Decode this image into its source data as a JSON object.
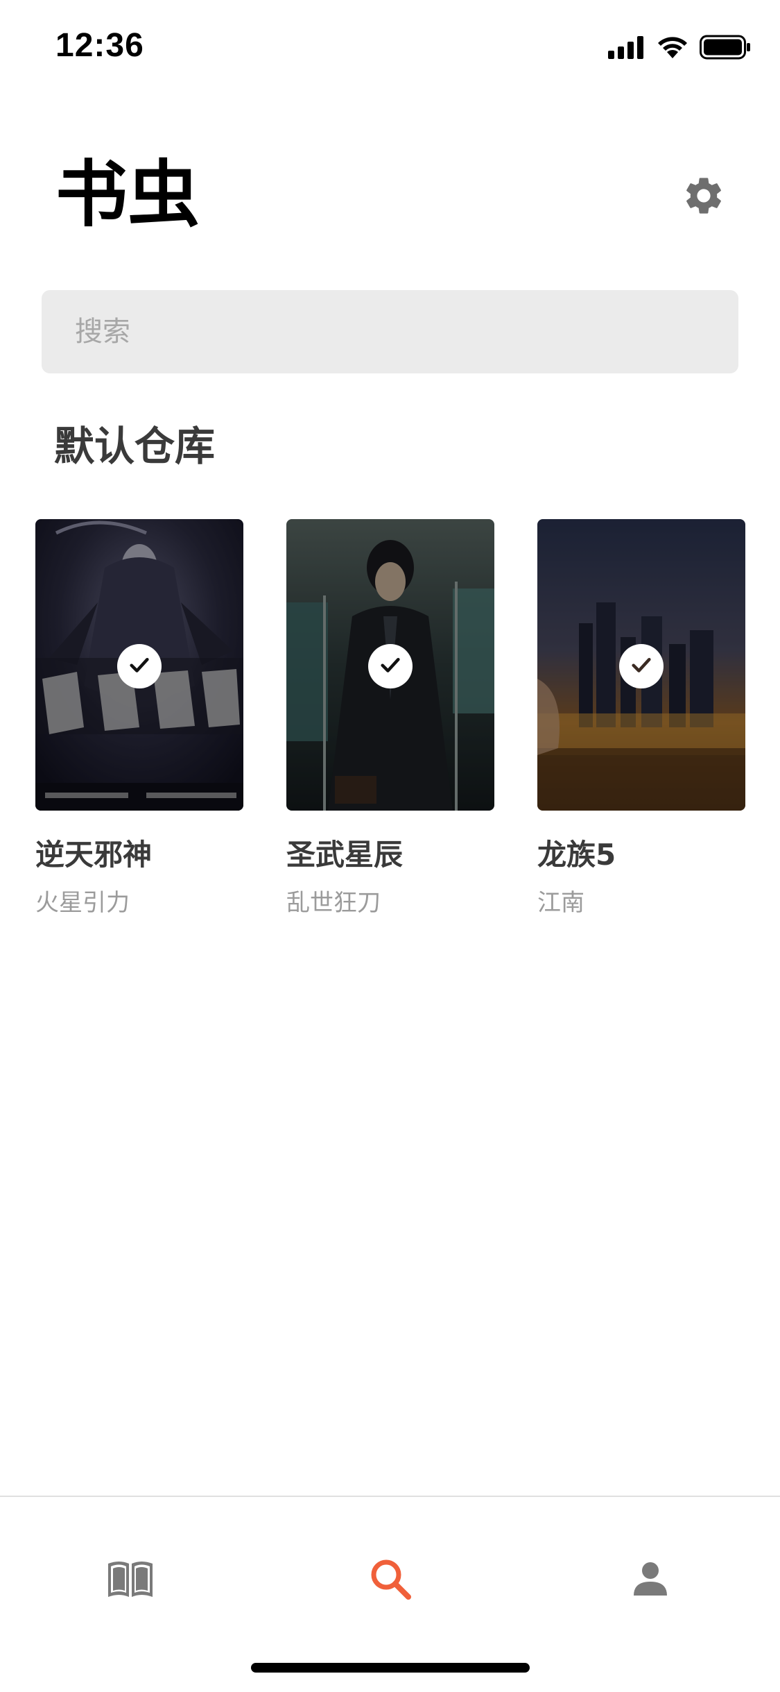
{
  "status_bar": {
    "time": "12:36",
    "icons": [
      "cellular-signal-icon",
      "wifi-icon",
      "battery-icon"
    ]
  },
  "header": {
    "title": "书虫",
    "settings_icon": "gear-icon"
  },
  "search": {
    "placeholder": "搜索",
    "value": ""
  },
  "section": {
    "title": "默认仓库"
  },
  "books": [
    {
      "title": "逆天邪神",
      "author": "火星引力",
      "selected": true
    },
    {
      "title": "圣武星辰",
      "author": "乱世狂刀",
      "selected": true
    },
    {
      "title": "龙族5",
      "author": "江南",
      "selected": true
    }
  ],
  "tab_bar": {
    "active": "search",
    "tabs": [
      {
        "id": "library",
        "icon": "open-book-icon"
      },
      {
        "id": "search",
        "icon": "search-icon"
      },
      {
        "id": "profile",
        "icon": "person-icon"
      }
    ]
  },
  "colors": {
    "accent": "#f0603a",
    "inactive_icon": "#7a7a7a",
    "search_bg": "#ebebeb"
  }
}
